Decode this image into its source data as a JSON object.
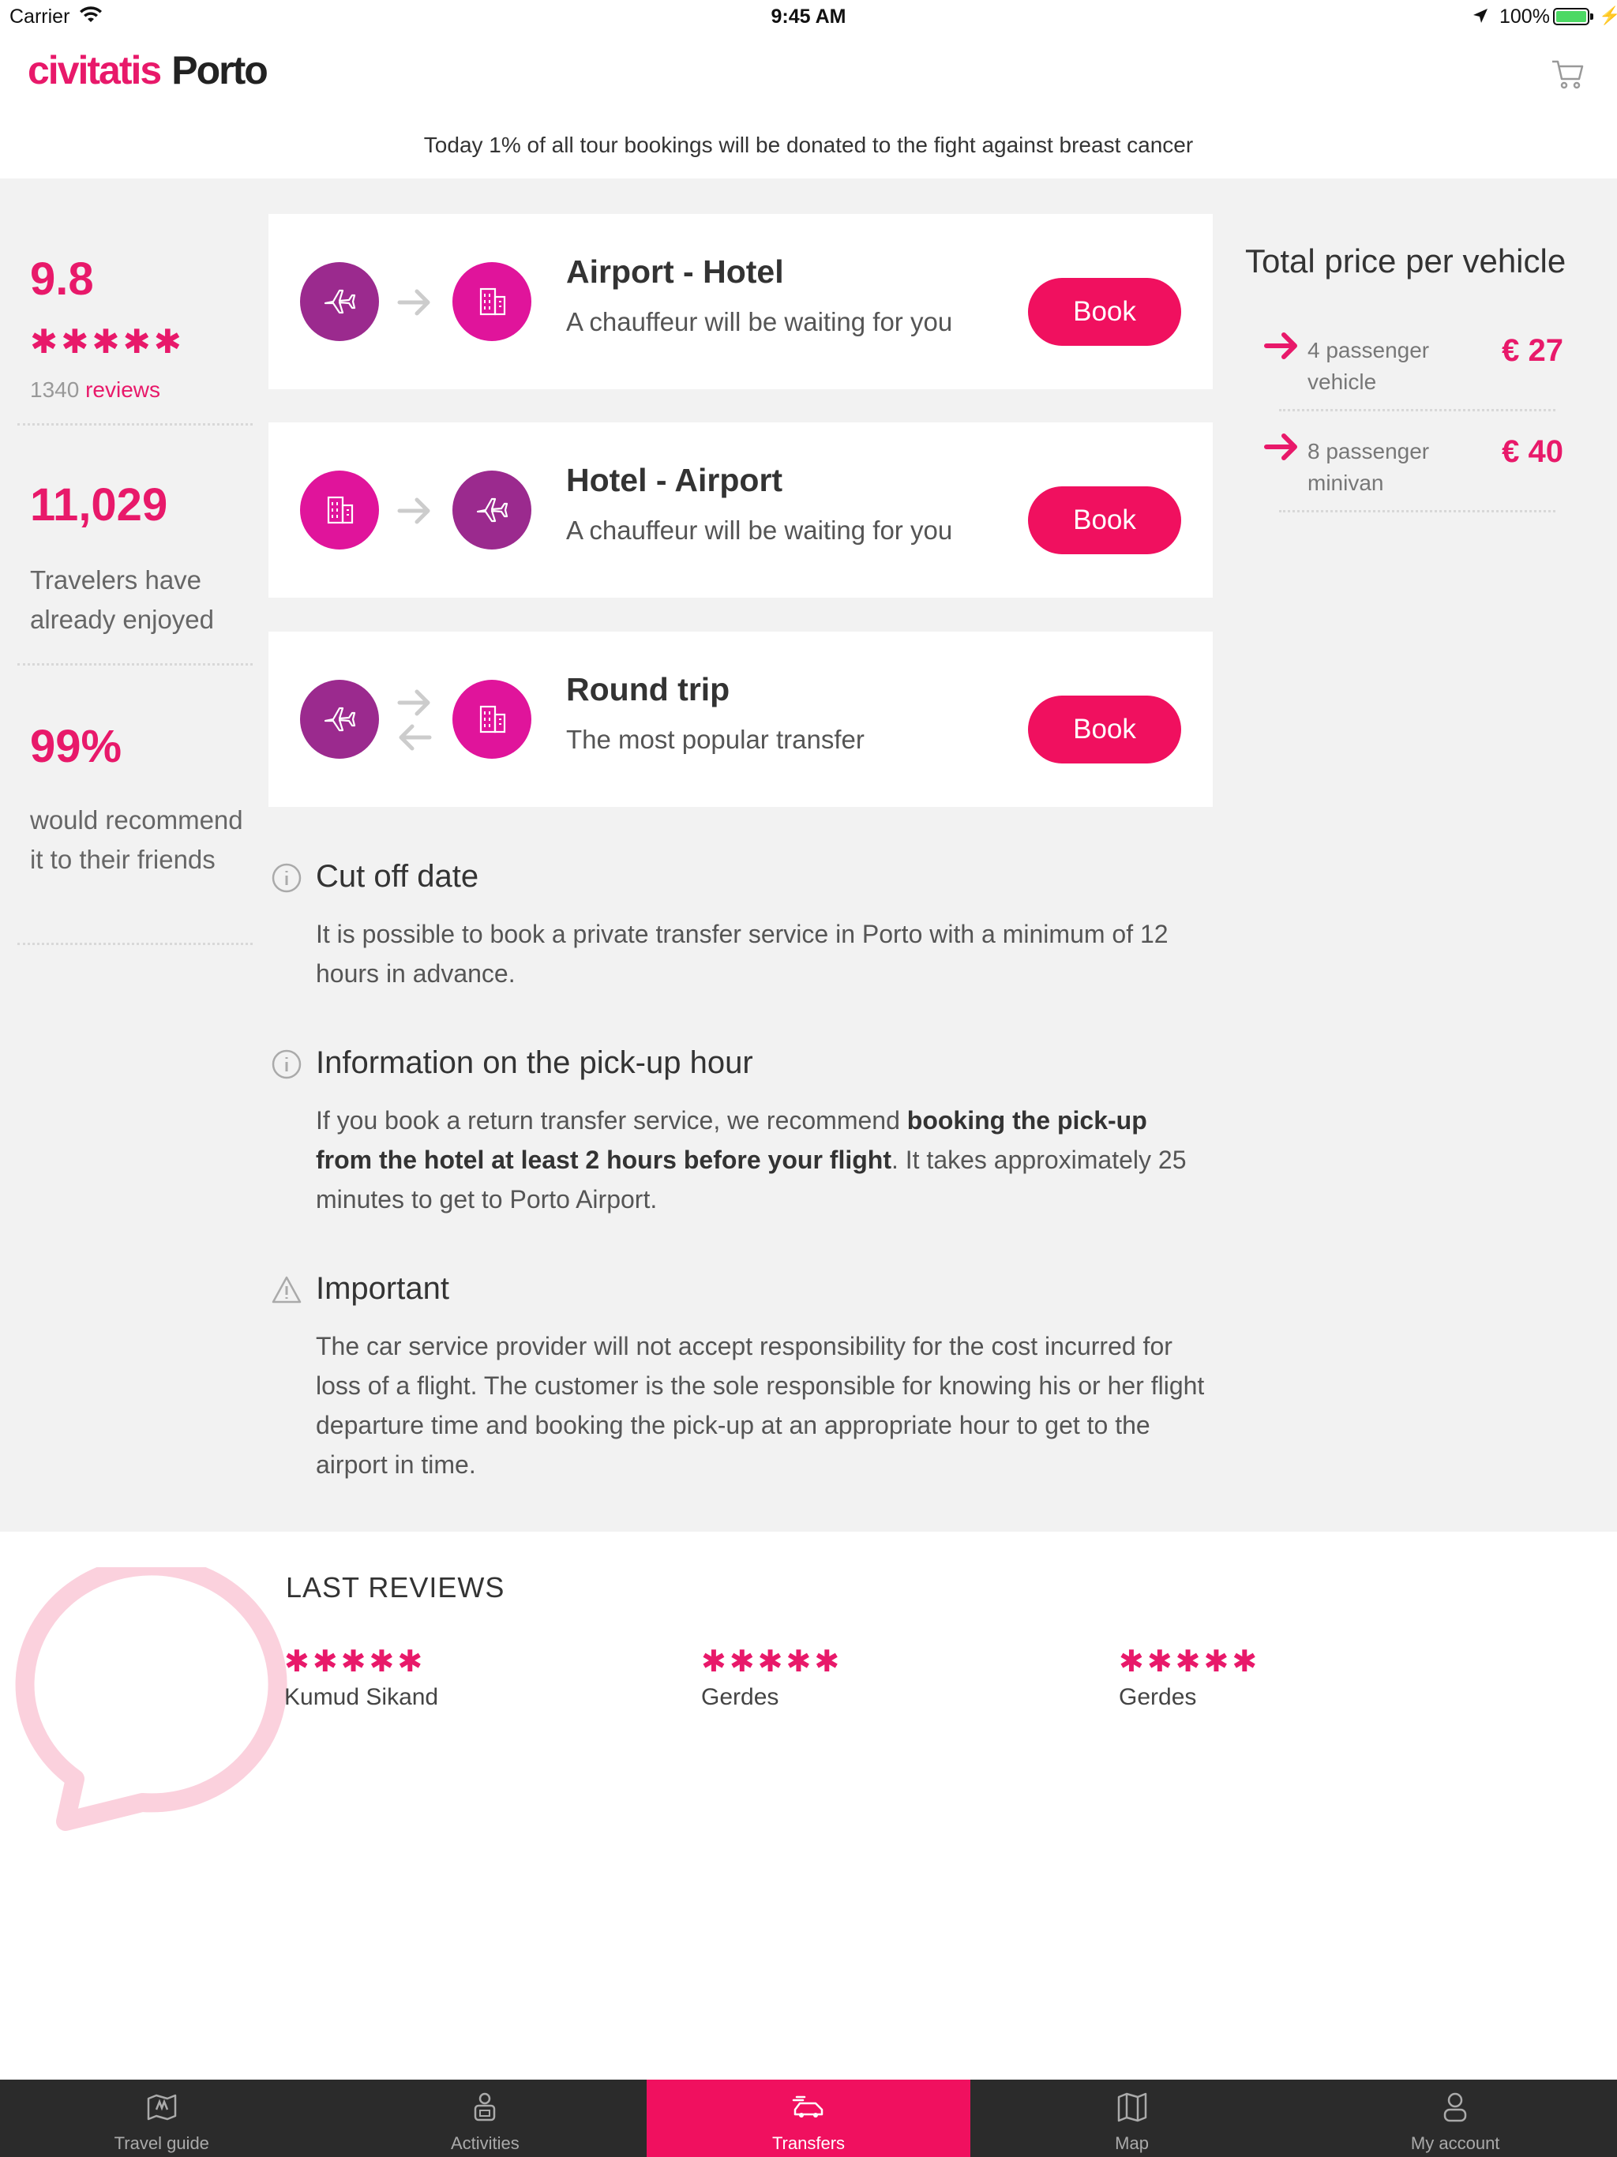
{
  "status_bar": {
    "carrier": "Carrier",
    "time": "9:45 AM",
    "battery": "100%"
  },
  "header": {
    "brand": "civitatis",
    "city": "Porto"
  },
  "banner": "Today 1% of all tour bookings will be donated to the fight against breast cancer",
  "stats": {
    "score": "9.8",
    "stars": "✱✱✱✱✱",
    "reviews_count": "1340",
    "reviews_label": "reviews",
    "travelers_count": "11,029",
    "travelers_text": "Travelers have already enjoyed",
    "recommend_pct": "99%",
    "recommend_text": "would recommend it to their friends"
  },
  "transfers": [
    {
      "title": "Airport - Hotel",
      "subtitle": "A chauffeur will be waiting for you",
      "button": "Book"
    },
    {
      "title": "Hotel - Airport",
      "subtitle": "A chauffeur will be waiting for you",
      "button": "Book"
    },
    {
      "title": "Round trip",
      "subtitle": "The most popular transfer",
      "button": "Book"
    }
  ],
  "price_panel": {
    "title": "Total price per vehicle",
    "rows": [
      {
        "label": "4 passenger vehicle",
        "price": "€ 27"
      },
      {
        "label": "8 passenger minivan",
        "price": "€ 40"
      }
    ]
  },
  "info": {
    "cutoff_title": "Cut off date",
    "cutoff_text": "It is possible to book a private transfer service in Porto with a minimum of 12 hours in advance.",
    "pickup_title": "Information on the pick-up hour",
    "pickup_text_1": "If you book a return transfer service, we recommend ",
    "pickup_text_bold": "booking the pick-up from the hotel at least 2 hours before your flight",
    "pickup_text_2": ". It takes approximately 25 minutes to get to Porto Airport.",
    "important_title": "Important",
    "important_text": "The car service provider will not accept responsibility for the cost incurred for loss of a flight. The customer is the sole responsible for knowing his or her flight departure time and booking the pick-up at an appropriate hour to get to the airport in time."
  },
  "reviews": {
    "title": "LAST REVIEWS",
    "items": [
      {
        "stars": "✱✱✱✱✱",
        "name": "Kumud Sikand"
      },
      {
        "stars": "✱✱✱✱✱",
        "name": "Gerdes"
      },
      {
        "stars": "✱✱✱✱✱",
        "name": "Gerdes"
      }
    ]
  },
  "tabbar": [
    {
      "label": "Travel guide",
      "icon": "map-pin-icon"
    },
    {
      "label": "Activities",
      "icon": "person-icon"
    },
    {
      "label": "Transfers",
      "icon": "car-icon",
      "active": true
    },
    {
      "label": "Map",
      "icon": "map-icon"
    },
    {
      "label": "My account",
      "icon": "user-icon"
    }
  ],
  "colors": {
    "accent": "#e8196a",
    "button": "#f0105f",
    "plane": "#9b2a8e",
    "building": "#e0149b",
    "tabbar": "#2b2b2b"
  }
}
